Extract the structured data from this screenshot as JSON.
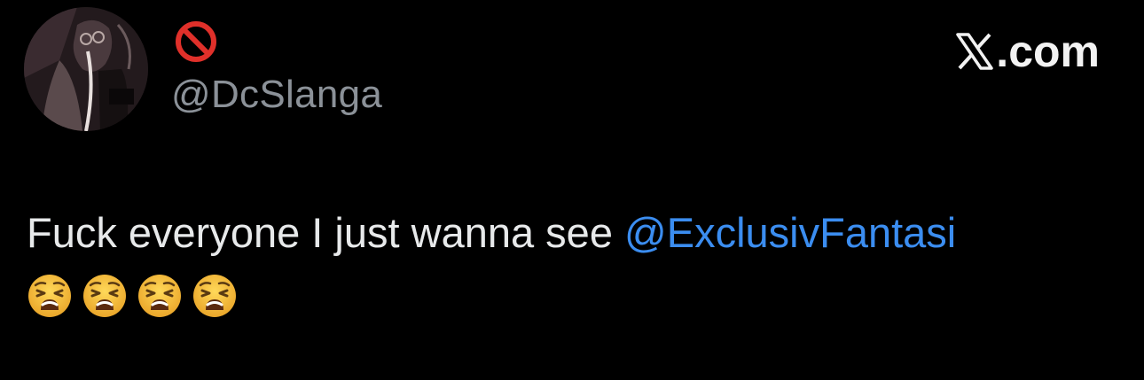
{
  "author": {
    "display_name_icon": "prohibited-icon",
    "handle": "@DcSlanga"
  },
  "source": {
    "logo_icon": "x-logo-icon",
    "label": ".com"
  },
  "tweet": {
    "text": "Fuck everyone I just wanna see ",
    "mention": "@ExclusivFantasi",
    "emojis": [
      "weary-face-icon",
      "weary-face-icon",
      "weary-face-icon",
      "weary-face-icon"
    ]
  },
  "colors": {
    "background": "#000000",
    "text": "#e7e9ea",
    "handle": "#8b9198",
    "mention": "#3b8df0",
    "prohibited": "#e0302a",
    "emoji": "#f7c23c"
  }
}
